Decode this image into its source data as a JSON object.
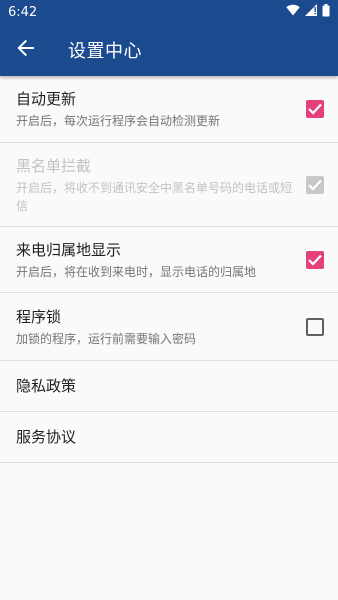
{
  "status_bar": {
    "time": "6:42"
  },
  "app_bar": {
    "title": "设置中心"
  },
  "settings": [
    {
      "title": "自动更新",
      "subtitle": "开启后，每次运行程序会自动检测更新",
      "checked": true,
      "enabled": true
    },
    {
      "title": "黑名单拦截",
      "subtitle": "开启后，将收不到通讯安全中黑名单号码的电话或短信",
      "checked": true,
      "enabled": false
    },
    {
      "title": "来电归属地显示",
      "subtitle": "开启后，将在收到来电时，显示电话的归属地",
      "checked": true,
      "enabled": true
    },
    {
      "title": "程序锁",
      "subtitle": "加锁的程序，运行前需要输入密码",
      "checked": false,
      "enabled": true
    }
  ],
  "links": [
    {
      "title": "隐私政策"
    },
    {
      "title": "服务协议"
    }
  ],
  "colors": {
    "primary": "#1b4a8f",
    "accent": "#e4407b",
    "disabled": "#c8c8c8"
  }
}
